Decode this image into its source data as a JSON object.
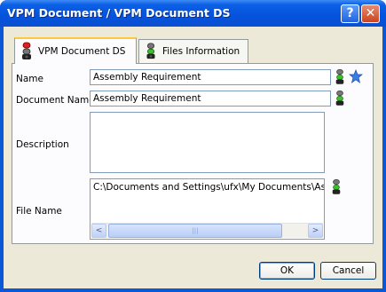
{
  "window": {
    "title": "VPM Document / VPM Document DS",
    "help_label": "?",
    "close_label": "✕"
  },
  "tabs": [
    {
      "label": "VPM Document DS"
    },
    {
      "label": "Files Information"
    }
  ],
  "form": {
    "name_label": "Name",
    "name_value": "Assembly Requirement",
    "document_name_label": "Document Name",
    "document_name_value": "Assembly Requirement",
    "description_label": "Description",
    "description_value": "",
    "file_name_label": "File Name",
    "file_name_value": "C:\\Documents and Settings\\ufx\\My Documents\\Assembly Requirement"
  },
  "scrollbar": {
    "left_arrow": "<",
    "right_arrow": ">",
    "thumb_grip": "|||"
  },
  "buttons": {
    "ok_label": "OK",
    "cancel_label": "Cancel"
  },
  "colors": {
    "title_bar": "#0553dd",
    "dialog_bg": "#ece9d8",
    "traffic_green": "#3bbf2a",
    "traffic_red": "#e02020",
    "star": "#3b7de0"
  },
  "icons": [
    "traffic-light-red-icon",
    "traffic-light-green-icon",
    "star-icon",
    "help-icon",
    "close-icon"
  ]
}
